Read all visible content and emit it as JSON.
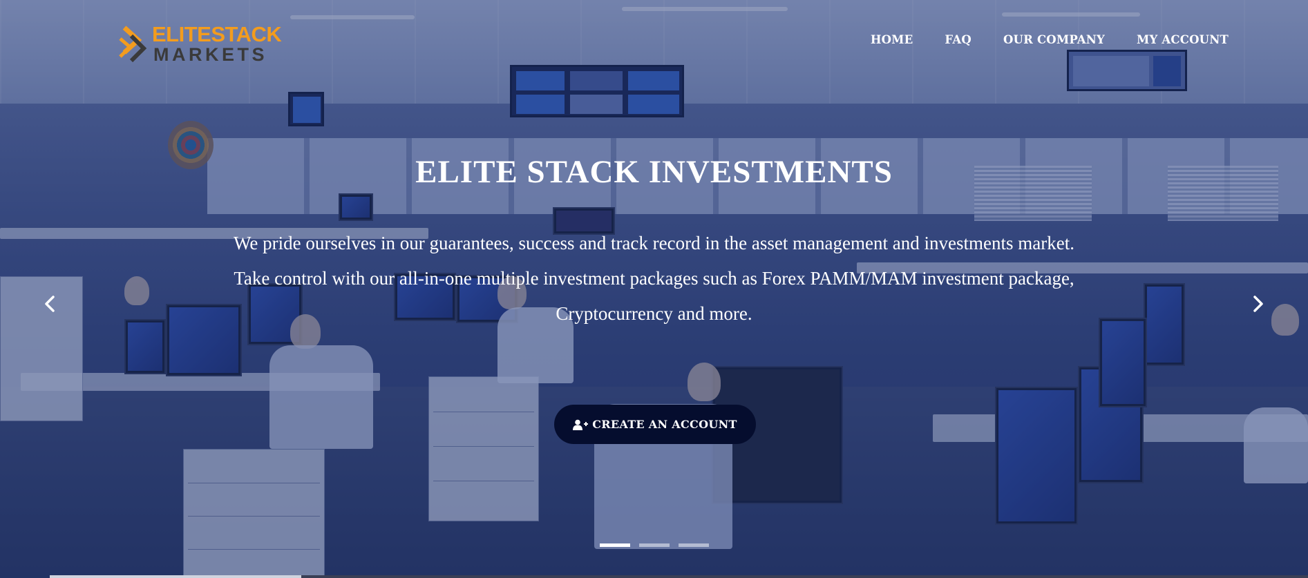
{
  "logo": {
    "line1": "ELITESTACK",
    "line2": "MARKETS",
    "mark_color": "#f39c1e",
    "text_color_1": "#f39c1e",
    "text_color_2": "#3a3a3a"
  },
  "nav": {
    "items": [
      {
        "label": "HOME"
      },
      {
        "label": "FAQ"
      },
      {
        "label": "OUR COMPANY"
      },
      {
        "label": "MY ACCOUNT"
      }
    ]
  },
  "hero": {
    "title": "ELITE STACK INVESTMENTS",
    "paragraph_1": "We pride ourselves in our guarantees, success and track record in the asset management and investments market.",
    "paragraph_2": "Take control with our all-in-one multiple investment packages such as Forex PAMM/MAM investment package, Cryptocurrency and more.",
    "cta_label": "CREATE AN ACCOUNT",
    "cta_icon": "user-plus-icon",
    "cta_color": "#050d2e"
  },
  "carousel": {
    "prev_icon": "chevron-left-icon",
    "next_icon": "chevron-right-icon",
    "slide_count": 3,
    "active_slide": 1,
    "progress_fraction": 0.2
  },
  "colors": {
    "accent": "#f39c1e",
    "overlay": "#1f3470"
  }
}
